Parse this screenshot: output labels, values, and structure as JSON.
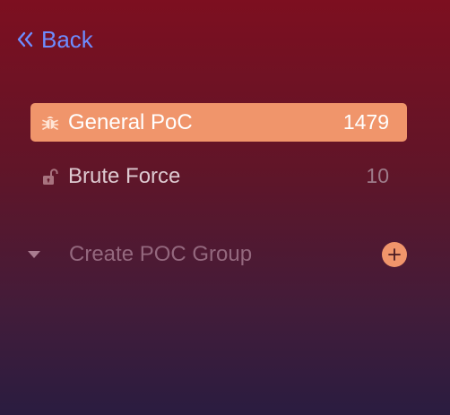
{
  "nav": {
    "back_label": "Back",
    "back_icon": "double-chevron-left-icon"
  },
  "categories": [
    {
      "label": "General PoC",
      "count": "1479",
      "icon": "bug-icon",
      "active": true
    },
    {
      "label": "Brute Force",
      "count": "10",
      "icon": "unlock-icon",
      "active": false
    }
  ],
  "group": {
    "create_label": "Create POC Group",
    "toggle_icon": "caret-down-icon",
    "add_icon": "plus-circle-icon"
  },
  "colors": {
    "accent": "#f0956b",
    "link": "#6d8cff",
    "background_top": "#7d0f20",
    "background_bottom": "#2a1c40"
  }
}
